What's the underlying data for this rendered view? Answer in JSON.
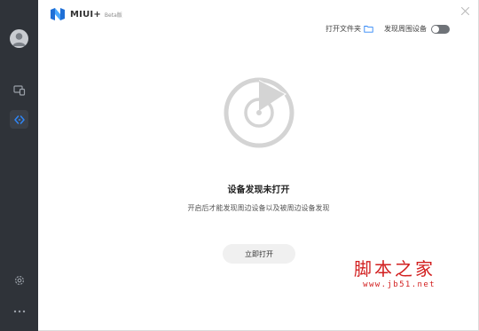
{
  "app": {
    "title": "MIUI+",
    "beta": "Beta版"
  },
  "header": {
    "open_folder_label": "打开文件夹",
    "discover_label": "发现周围设备",
    "discover_enabled": false
  },
  "sidebar": {
    "icons": [
      "avatar-icon",
      "devices-icon",
      "nearby-share-icon",
      "settings-icon",
      "more-icon"
    ],
    "active": "nearby-share-icon"
  },
  "main": {
    "status_title": "设备发现未打开",
    "status_desc": "开启后才能发现周边设备以及被周边设备发现",
    "open_button": "立即打开"
  },
  "watermark": {
    "main": "脚本之家",
    "url": "www.jb51.net"
  },
  "colors": {
    "sidebar_bg": "#2f3339",
    "accent_blue": "#2f86f6",
    "watermark_red": "#d21f1f",
    "disc_gray": "#d4d4d4"
  }
}
